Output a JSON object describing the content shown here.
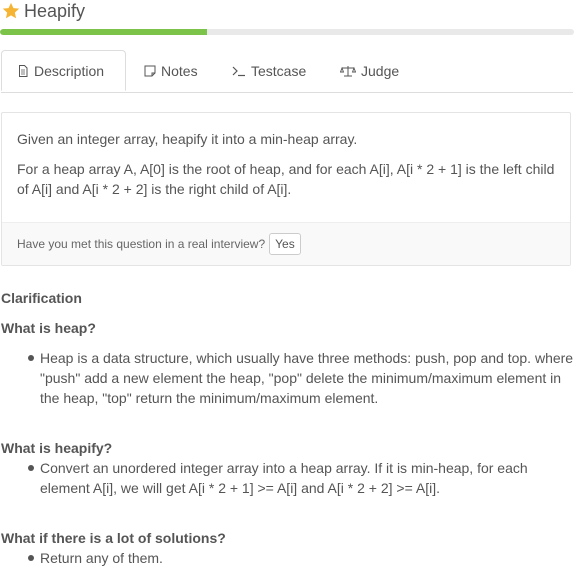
{
  "problem": {
    "title": "Heapify",
    "progress_fraction": 0.36
  },
  "tabs": [
    {
      "label": "Description"
    },
    {
      "label": "Notes"
    },
    {
      "label": "Testcase"
    },
    {
      "label": "Judge"
    }
  ],
  "description": {
    "para1": "Given an integer array, heapify it into a min-heap array.",
    "para2": "For a heap array A, A[0] is the root of heap, and for each A[i], A[i * 2 + 1] is the left child of A[i] and A[i * 2 + 2] is the right child of A[i].",
    "interview_question": "Have you met this question in a real interview?",
    "yes_label": "Yes"
  },
  "clarification": {
    "heading": "Clarification",
    "sections": [
      {
        "heading": "What is heap?",
        "items": [
          "Heap is a data structure, which usually have three methods: push, pop and top. where \"push\" add a new element the heap, \"pop\" delete the minimum/maximum element in the heap, \"top\" return the minimum/maximum element."
        ]
      },
      {
        "heading": "What is heapify?",
        "items": [
          "Convert an unordered integer array into a heap array. If it is min-heap, for each element A[i], we will get A[i * 2 + 1] >= A[i] and A[i * 2 + 2] >= A[i]."
        ]
      },
      {
        "heading": "What if there is a lot of solutions?",
        "items": [
          "Return any of them."
        ]
      }
    ]
  },
  "colors": {
    "star": "#f5b433",
    "progress_fill": "#7cc34a",
    "progress_track": "#e9e9e9"
  }
}
